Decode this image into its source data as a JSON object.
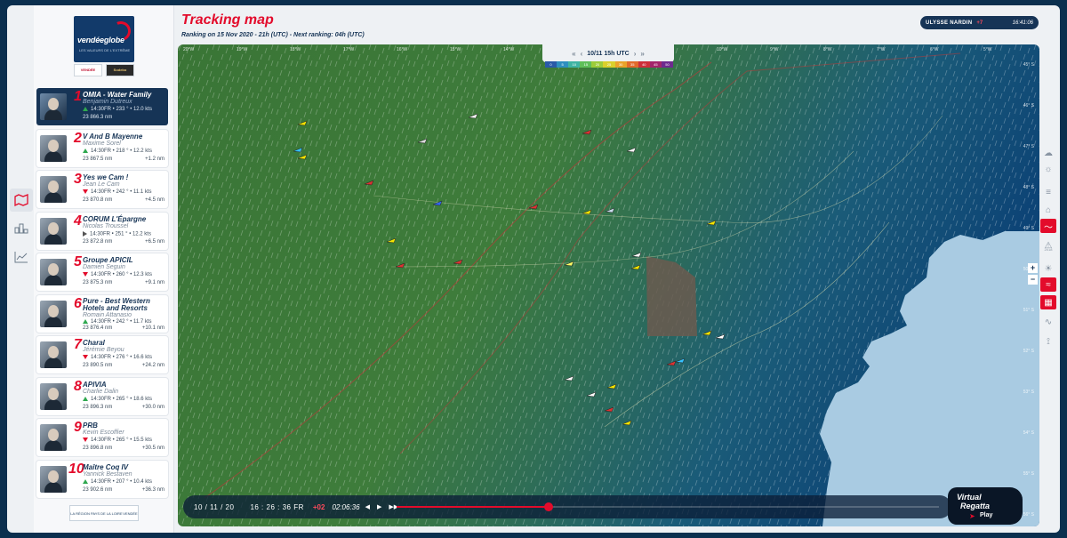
{
  "header": {
    "title": "Tracking map",
    "ranking_info": "Ranking on 15 Nov 2020 - 21h (UTC)  -  Next ranking: 04h (UTC)"
  },
  "watch": {
    "brand": "ULYSSE NARDIN",
    "timezone": "+7",
    "time": "16:41:06"
  },
  "logo": {
    "wordmark": "vendéeglobe",
    "tagline": "LES VALEURS DE L'EXTRÊME",
    "sponsors": [
      "VENDÉE",
      "Sodebo"
    ]
  },
  "footer_logos": [
    "LA RÉGION PAYS DE LA LOIRE",
    "VENDÉE"
  ],
  "rail": {
    "items": [
      "map-icon",
      "ranking-icon",
      "chart-icon"
    ]
  },
  "leaderboard": [
    {
      "rank": "1",
      "boat": "OMIA - Water Family",
      "skipper": "Benjamin Dutreux",
      "stats": "14:30FR • 233 ° • 12.0 kts",
      "trend": "up",
      "dtf": "23 866.3 nm",
      "gap": ""
    },
    {
      "rank": "2",
      "boat": "V And B Mayenne",
      "skipper": "Maxime Sorel",
      "stats": "14:30FR • 218 ° • 12.2 kts",
      "trend": "up",
      "dtf": "23 867.5 nm",
      "gap": "+1.2 nm"
    },
    {
      "rank": "3",
      "boat": "Yes we Cam !",
      "skipper": "Jean Le Cam",
      "stats": "14:30FR • 242 ° • 11.1 kts",
      "trend": "down",
      "dtf": "23 870.8 nm",
      "gap": "+4.5 nm"
    },
    {
      "rank": "4",
      "boat": "CORUM L'Épargne",
      "skipper": "Nicolas Troussel",
      "stats": "14:30FR • 251 ° • 12.2 kts",
      "trend": "right",
      "dtf": "23 872.8 nm",
      "gap": "+6.5 nm"
    },
    {
      "rank": "5",
      "boat": "Groupe APICIL",
      "skipper": "Damien Seguin",
      "stats": "14:30FR • 260 ° • 12.3 kts",
      "trend": "down",
      "dtf": "23 875.3 nm",
      "gap": "+9.1 nm"
    },
    {
      "rank": "6",
      "boat": "Pure - Best Western Hotels and Resorts",
      "skipper": "Romain Attanasio",
      "stats": "14:30FR • 242 ° • 11.7 kts",
      "trend": "up",
      "dtf": "23 876.4 nm",
      "gap": "+10.1 nm"
    },
    {
      "rank": "7",
      "boat": "Charal",
      "skipper": "Jérémie Beyou",
      "stats": "14:30FR • 276 ° • 16.6 kts",
      "trend": "down",
      "dtf": "23 890.5 nm",
      "gap": "+24.2 nm"
    },
    {
      "rank": "8",
      "boat": "APIVIA",
      "skipper": "Charlie Dalin",
      "stats": "14:30FR • 265 ° • 18.6 kts",
      "trend": "up",
      "dtf": "23 896.3 nm",
      "gap": "+30.0 nm"
    },
    {
      "rank": "9",
      "boat": "PRB",
      "skipper": "Kevin Escoffier",
      "stats": "14:30FR • 265 ° • 15.5 kts",
      "trend": "down",
      "dtf": "23 896.8 nm",
      "gap": "+30.5 nm"
    },
    {
      "rank": "10",
      "boat": "Maître Coq IV",
      "skipper": "Yannick Bestaven",
      "stats": "14:30FR • 207 ° • 10.4 kts",
      "trend": "up",
      "dtf": "23 902.6 nm",
      "gap": "+36.3 nm"
    }
  ],
  "time_control": {
    "label": "10/11 15h UTC",
    "first": "«",
    "prev": "‹",
    "next": "›",
    "last": "»"
  },
  "wind_legend": {
    "values": [
      "0",
      "5",
      "10",
      "15",
      "20",
      "25",
      "30",
      "35",
      "40",
      "45",
      "50"
    ],
    "colors": [
      "#2a5aa8",
      "#2f8fc0",
      "#3fb4a3",
      "#5fbf5a",
      "#9ccc3a",
      "#d9d02c",
      "#eaa22a",
      "#e26a2b",
      "#cf2f3a",
      "#a3246b",
      "#6e2a8f"
    ]
  },
  "playback": {
    "date": "10 / 11 / 20",
    "time": "16 : 26 : 36 FR",
    "speed": "+02",
    "elapsed": "02:06:36",
    "progress": 0.28
  },
  "virtual_regatta": {
    "line1": "Virtual",
    "line2": "Regatta",
    "line3": "Play"
  },
  "map_tools": [
    "cloud-icon",
    "sunrise-icon",
    "layers-icon",
    "tag-icon",
    "wind-icon",
    "ice-zone-icon",
    "sun-icon",
    "waves-icon",
    "grid-icon",
    "cable-icon",
    "pressure-icon"
  ],
  "map_tool_labels": {
    "year": "2018"
  },
  "lat_labels": [
    "45° S",
    "46° S",
    "47° S",
    "48° S",
    "49° S",
    "50° S",
    "51° S",
    "52° S",
    "53° S",
    "54° S",
    "55° S",
    "56° S"
  ],
  "lon_labels": [
    "20°W",
    "19°W",
    "18°W",
    "17°W",
    "16°W",
    "15°W",
    "14°W",
    "13°W",
    "12°W",
    "11°W",
    "10°W",
    "9°W",
    "8°W",
    "7°W",
    "6°W",
    "5°W"
  ],
  "colors": {
    "accent": "#e30b2b",
    "navy": "#163456",
    "sea_green": "#3f7a3c",
    "sea_blue": "#0f4c7f",
    "land": "#a9cbe2"
  }
}
